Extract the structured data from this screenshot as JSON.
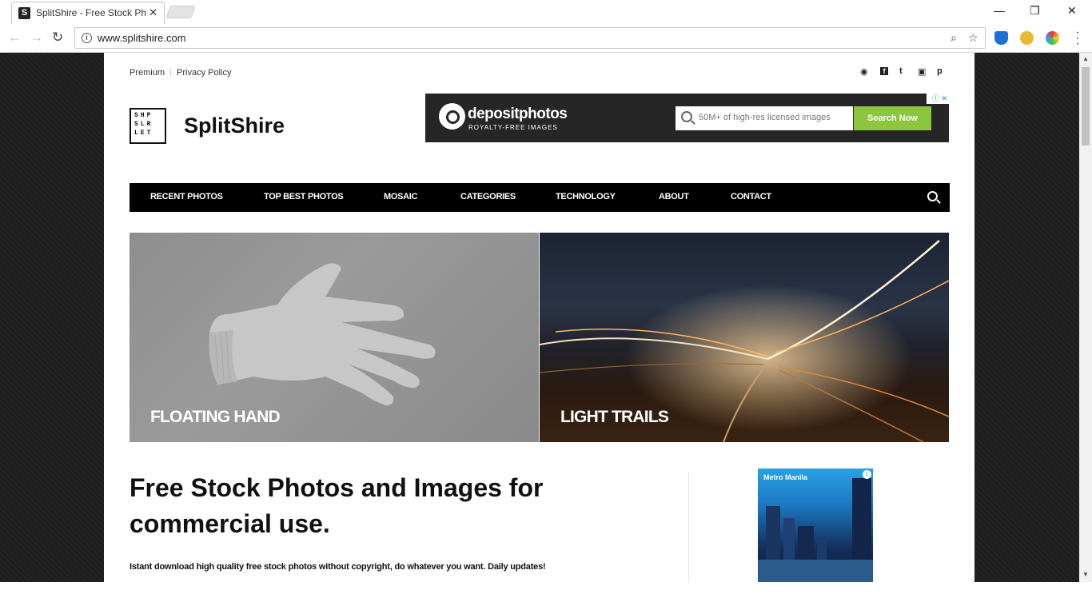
{
  "browser": {
    "tab_title": "SplitShire - Free Stock Ph",
    "tab_favicon": "S",
    "tab_close": "✕",
    "url": "www.splitshire.com",
    "window_controls": {
      "minimize": "—",
      "restore": "❐",
      "close": "✕"
    }
  },
  "site": {
    "top_links": [
      "Premium",
      "Privacy Policy"
    ],
    "social_icons": [
      "rss-icon",
      "facebook-icon",
      "twitter-icon",
      "instagram-icon",
      "pinterest-icon"
    ],
    "social_glyphs": [
      "◉",
      "f",
      "t",
      "▣",
      "p"
    ],
    "logo_letters": [
      "SHP",
      "SLR",
      "LET"
    ],
    "brand_name": "SplitShire"
  },
  "ad_banner": {
    "brand": "depositphotos",
    "tagline": "ROYALTY-FREE IMAGES",
    "search_placeholder": "50M+ of high-res licensed images",
    "search_button": "Search Now",
    "adchoices": "ⓘ ✕"
  },
  "nav": {
    "items": [
      "RECENT PHOTOS",
      "TOP BEST PHOTOS",
      "MOSAIC",
      "CATEGORIES",
      "TECHNOLOGY",
      "ABOUT",
      "CONTACT"
    ]
  },
  "featured": [
    {
      "caption": "FLOATING HAND"
    },
    {
      "caption": "LIGHT TRAILS"
    }
  ],
  "intro": {
    "headline": "Free Stock Photos and Images for commercial use.",
    "subline": "Istant download high quality free stock photos without copyright, do whatever you want. Daily updates!"
  },
  "side_ad": {
    "label": "Metro Manila",
    "info": "i"
  },
  "colors": {
    "nav_bg": "#000000",
    "ad_bg": "#262626",
    "ad_button": "#8cc63f",
    "page_bg": "#1e1e1e"
  }
}
